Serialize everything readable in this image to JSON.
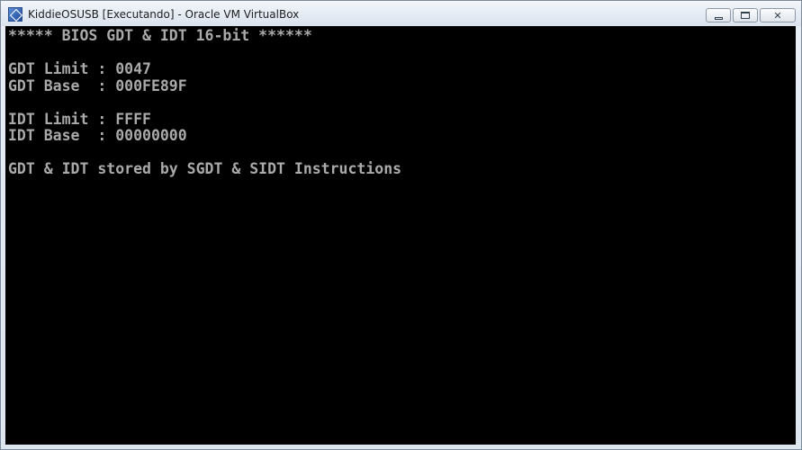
{
  "window": {
    "title": "KiddieOSUSB [Executando] - Oracle VM VirtualBox",
    "icon": "virtualbox-icon",
    "controls": {
      "minimize_icon": "minimize-icon",
      "maximize_icon": "maximize-icon",
      "close_symbol": "✕"
    }
  },
  "console": {
    "foreground": "#aaaaaa",
    "background": "#000000",
    "lines": [
      "***** BIOS GDT & IDT 16-bit ******",
      "",
      "GDT Limit : 0047",
      "GDT Base  : 000FE89F",
      "",
      "IDT Limit : FFFF",
      "IDT Base  : 00000000",
      "",
      "GDT & IDT stored by SGDT & SIDT Instructions"
    ]
  }
}
